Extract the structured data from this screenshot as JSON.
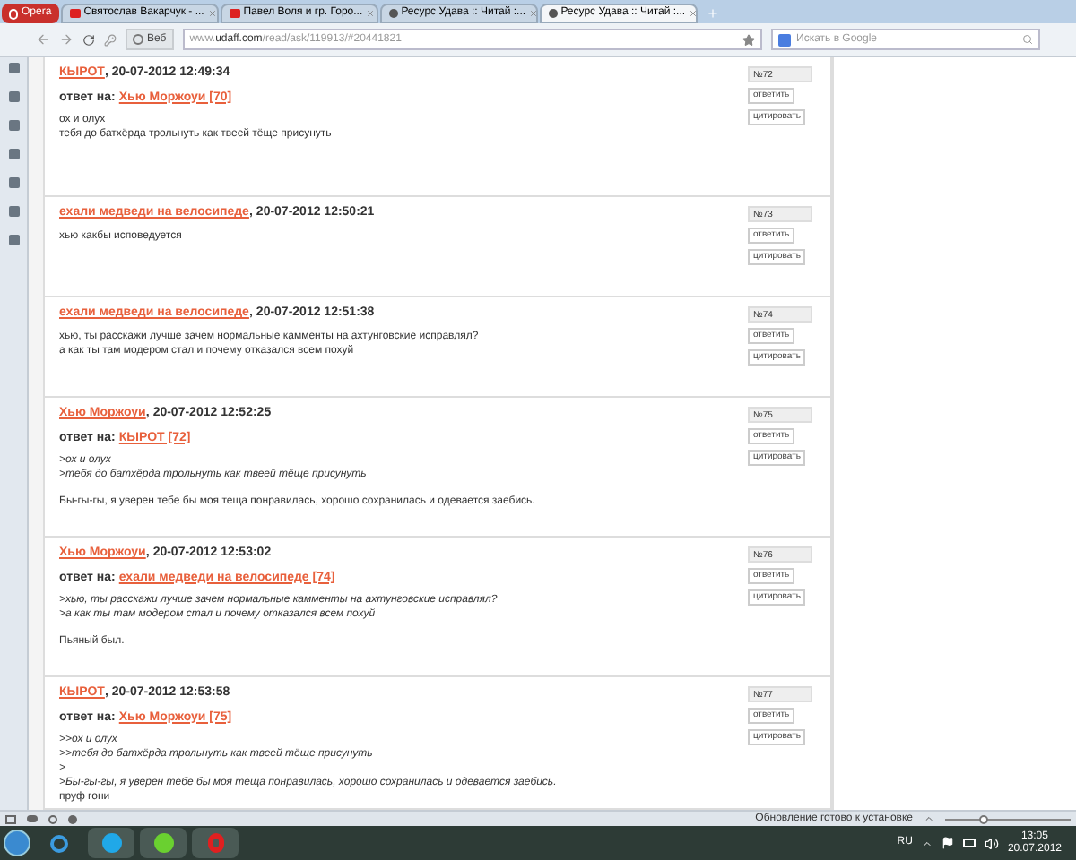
{
  "tabs": [
    {
      "label": "Opera",
      "kind": "menu",
      "selected": false
    },
    {
      "label": "Святослав Вакарчук - ...",
      "kind": "video",
      "selected": false
    },
    {
      "label": "Павел Воля и гр. Горо...",
      "kind": "video",
      "selected": false
    },
    {
      "label": "Ресурс Удава :: Читай :...",
      "kind": "site",
      "selected": false
    },
    {
      "label": "Ресурс Удава :: Читай :...",
      "kind": "site",
      "selected": true
    }
  ],
  "address_bar": {
    "badge": "Веб",
    "url_prefix": "www.",
    "url_domain": "udaff.com",
    "url_path": "/read/ask/119913/#20441821",
    "search_placeholder": "Искать в Google"
  },
  "comments": [
    {
      "author": "КЫРОТ",
      "separator": ",",
      "date": "20-07-2012 12:49:34",
      "reply_label": "ответ на:",
      "reply_to": "Хью Моржоуи [70]",
      "number": "№72",
      "reply_button": "ответить",
      "quote_button": "цитировать",
      "lines": [
        {
          "kind": "text",
          "text": "ох и олух"
        },
        {
          "kind": "text",
          "text": "тебя до батхёрда трольнуть как твеей тёще присунуть"
        }
      ]
    },
    {
      "author": "ехали медведи на велосипеде",
      "separator": ",",
      "date": "20-07-2012 12:50:21",
      "number": "№73",
      "reply_button": "ответить",
      "quote_button": "цитировать",
      "lines": [
        {
          "kind": "text",
          "text": "хью какбы исповедуется"
        }
      ]
    },
    {
      "author": "ехали медведи на велосипеде",
      "separator": ",",
      "date": "20-07-2012 12:51:38",
      "number": "№74",
      "reply_button": "ответить",
      "quote_button": "цитировать",
      "lines": [
        {
          "kind": "text",
          "text": "хью, ты расскажи лучше зачем нормальные камменты на ахтунговские исправлял?"
        },
        {
          "kind": "text",
          "text": "а как ты там модером стал и почему отказался всем похуй"
        }
      ]
    },
    {
      "author": "Хью Моржоуи",
      "separator": ",",
      "date": "20-07-2012 12:52:25",
      "reply_label": "ответ на:",
      "reply_to": "КЫРОТ [72]",
      "number": "№75",
      "reply_button": "ответить",
      "quote_button": "цитировать",
      "lines": [
        {
          "kind": "quote",
          "text": ">ох и олух"
        },
        {
          "kind": "quote",
          "text": ">тебя до батхёрда трольнуть как твеей тёще присунуть"
        },
        {
          "kind": "gap"
        },
        {
          "kind": "text",
          "text": "Бы-гы-гы, я уверен тебе бы моя теща понравилась, хорошо сохранилась и одевается заебись."
        }
      ]
    },
    {
      "author": "Хью Моржоуи",
      "separator": ",",
      "date": "20-07-2012 12:53:02",
      "reply_label": "ответ на:",
      "reply_to": "ехали медведи на велосипеде [74]",
      "number": "№76",
      "reply_button": "ответить",
      "quote_button": "цитировать",
      "lines": [
        {
          "kind": "quote",
          "text": ">хью, ты расскажи лучше зачем нормальные камменты на ахтунговские исправлял?"
        },
        {
          "kind": "quote",
          "text": ">а как ты там модером стал и почему отказался всем похуй"
        },
        {
          "kind": "gap"
        },
        {
          "kind": "text",
          "text": "Пьяный был."
        }
      ]
    },
    {
      "author": "КЫРОТ",
      "separator": ",",
      "date": "20-07-2012 12:53:58",
      "reply_label": "ответ на:",
      "reply_to": "Хью Моржоуи [75]",
      "number": "№77",
      "reply_button": "ответить",
      "quote_button": "цитировать",
      "lines": [
        {
          "kind": "quote",
          "text": ">>ох и олух"
        },
        {
          "kind": "quote",
          "text": ">>тебя до батхёрда трольнуть как твеей тёще присунуть"
        },
        {
          "kind": "quote",
          "text": ">"
        },
        {
          "kind": "quote",
          "text": ">Бы-гы-гы, я уверен тебе бы моя теща понравилась, хорошо сохранилась и одевается заебись."
        },
        {
          "kind": "text",
          "text": "пруф гони"
        }
      ]
    }
  ],
  "status_bar": {
    "message": "Обновление готово к установке",
    "zoom": {
      "level": 0.3
    }
  },
  "taskbar": {
    "language": "RU",
    "time": "13:05",
    "date": "20.07.2012"
  }
}
